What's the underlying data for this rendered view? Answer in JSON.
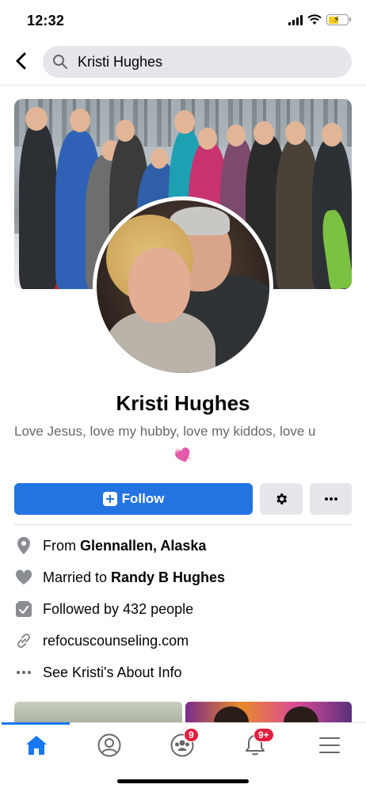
{
  "status_bar": {
    "time": "12:32"
  },
  "search": {
    "query": "Kristi Hughes",
    "icons": {
      "back": "chevron-left-icon",
      "search": "search-icon"
    }
  },
  "profile": {
    "name": "Kristi Hughes",
    "bio": "Love Jesus, love my hubby, love my kiddos, love u",
    "bio_emoji": "sparkling-heart-emoji"
  },
  "actions": {
    "follow_label": "Follow",
    "settings_icon": "gear-icon",
    "more_icon": "more-dots-icon",
    "accent_color": "#2374e1"
  },
  "details": {
    "from_prefix": "From",
    "from_place": "Glennallen, Alaska",
    "married_prefix": "Married to",
    "married_name": "Randy B Hughes",
    "followers": "Followed by 432 people",
    "website": "refocuscounseling.com",
    "about_link": "See Kristi's About Info"
  },
  "bottom_nav": {
    "items": [
      {
        "name": "home",
        "icon": "home-icon",
        "active": true
      },
      {
        "name": "profile",
        "icon": "profile-icon"
      },
      {
        "name": "groups",
        "icon": "groups-icon",
        "badge": "9"
      },
      {
        "name": "notifications",
        "icon": "bell-icon",
        "badge": "9+"
      },
      {
        "name": "menu",
        "icon": "menu-icon"
      }
    ],
    "active_color": "#1877f2",
    "badge_color": "#e41e3f"
  }
}
